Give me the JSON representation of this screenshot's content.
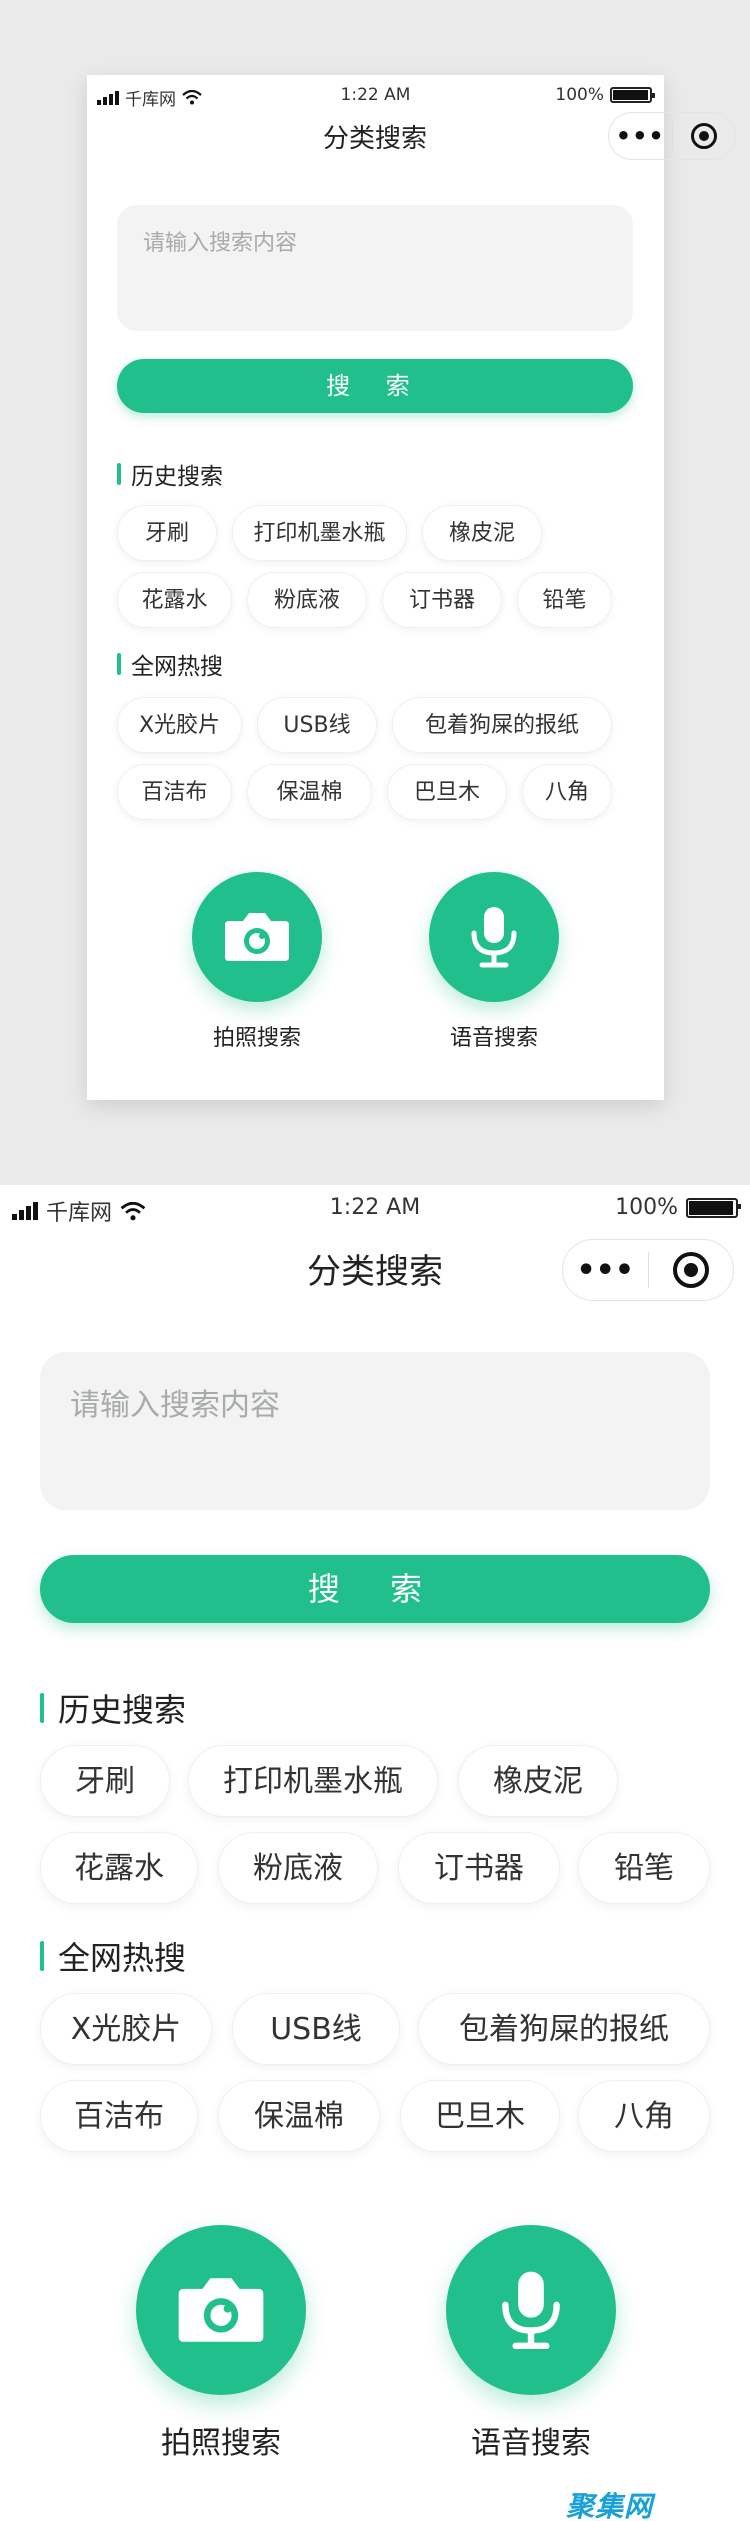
{
  "status_bar": {
    "carrier": "千库网",
    "time": "1:22 AM",
    "battery": "100%"
  },
  "nav": {
    "title": "分类搜索",
    "more_icon": "•••"
  },
  "search": {
    "placeholder": "请输入搜索内容",
    "button_label": "搜 索"
  },
  "history": {
    "title": "历史搜索",
    "items": [
      "牙刷",
      "打印机墨水瓶",
      "橡皮泥",
      "花露水",
      "粉底液",
      "订书器",
      "铅笔"
    ]
  },
  "hot": {
    "title": "全网热搜",
    "items": [
      "X光胶片",
      "USB线",
      "包着狗屎的报纸",
      "百洁布",
      "保温棉",
      "巴旦木",
      "八角"
    ]
  },
  "actions": {
    "photo_label": "拍照搜索",
    "voice_label": "语音搜索"
  },
  "icons": {
    "photo": "camera-icon",
    "voice": "microphone-icon"
  },
  "colors": {
    "accent": "#21bf8b",
    "input_bg": "#f2f3f2"
  },
  "footer": {
    "logo": "聚集网"
  }
}
